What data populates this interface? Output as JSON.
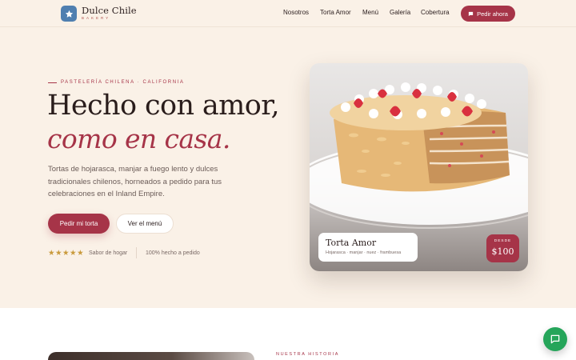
{
  "header": {
    "brand_name": "Dulce Chile",
    "brand_sub": "BAKERY",
    "nav": [
      "Nosotros",
      "Torta Amor",
      "Menú",
      "Galería",
      "Cobertura"
    ],
    "order_button": "Pedir ahora"
  },
  "hero": {
    "eyebrow": "PASTELERÍA CHILENA · CALIFORNIA",
    "title_line1": "Hecho con amor,",
    "title_line2": "como en casa.",
    "description": "Tortas de hojarasca, manjar a fuego lento y dulces tradicionales chilenos, horneados a pedido para tus celebraciones en el Inland Empire.",
    "primary_button": "Pedir mi torta",
    "secondary_button": "Ver el menú",
    "stars": "★★★★★",
    "rating": 5,
    "rating_label": "Sabor de hogar",
    "made_label": "100% hecho a pedido"
  },
  "card": {
    "product_name": "Torta Amor",
    "ingredients": "Hojarasca · manjar · nuez · frambuesa",
    "price_prefix": "DESDE",
    "price": "$100"
  },
  "story": {
    "eyebrow": "NUESTRA HISTORIA"
  },
  "colors": {
    "accent": "#a63448",
    "background": "#faf1e7",
    "chat": "#25a55a",
    "logo": "#4f7fb0"
  },
  "icons": [
    "star-icon",
    "chat-icon",
    "whatsapp-icon"
  ]
}
